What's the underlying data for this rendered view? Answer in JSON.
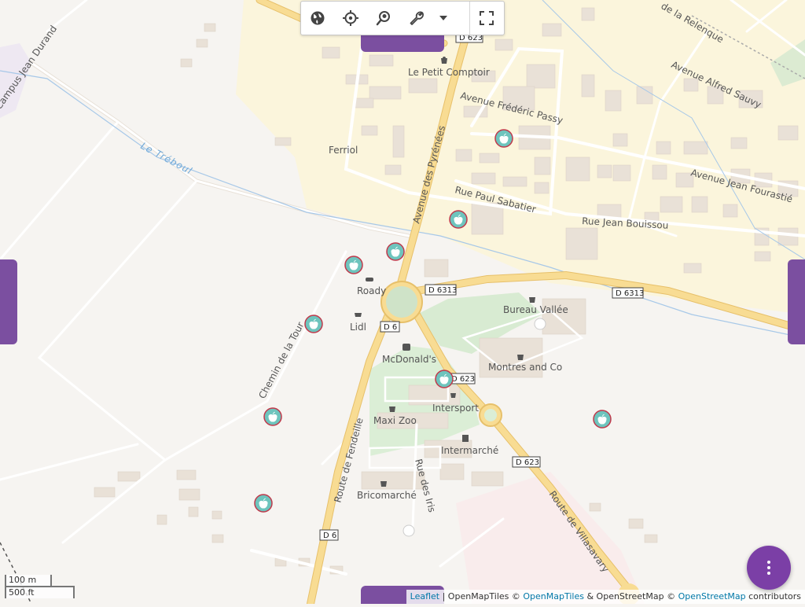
{
  "toolbar": {
    "buttons": [
      {
        "icon": "globe-icon"
      },
      {
        "icon": "crosshair-icon"
      },
      {
        "icon": "search-location-icon"
      },
      {
        "icon": "wrench-icon"
      },
      {
        "icon": "caret-down-icon"
      },
      {
        "icon": "fullscreen-icon"
      }
    ]
  },
  "places": {
    "le_petit_comptoir": "Le Petit Comptoir",
    "ferriol": "Ferriol",
    "roady": "Roady",
    "lidl": "Lidl",
    "mcdonalds": "McDonald's",
    "bureau_vallee": "Bureau Vallée",
    "montres_et_co": "Montres and Co",
    "intersport": "Intersport",
    "maxi_zoo": "Maxi Zoo",
    "intermarche": "Intermarché",
    "bricomarche": "Bricomarché"
  },
  "streets": {
    "campus_jean_durand": "Campus Jean Durand",
    "avenue_des_pyrenees": "Avenue des Pyrénées",
    "avenue_frederic_passy": "Avenue Frédéric Passy",
    "avenue_alfred_sauvy": "Avenue Alfred Sauvy",
    "rue_de_la_relenque": "de la Relenque",
    "avenue_jean_fourastie": "Avenue Jean Fourastié",
    "rue_paul_sabatier": "Rue Paul Sabatier",
    "rue_jean_bouissou": "Rue Jean Bouissou",
    "chemin_de_la_tour": "Chemin de la Tour",
    "route_de_fendeille": "Route de Fendeille",
    "rue_des_iris": "Rue des Iris",
    "route_de_villasavary": "Route de Villasavary",
    "le_treboul": "Le Tréboul"
  },
  "road_shields": {
    "d623_top": "D 623",
    "d6313_left": "D 6313",
    "d6313_right": "D 6313",
    "d6_top": "D 6",
    "d623_mid": "D 623",
    "d623_lower": "D 623",
    "d6_bottom": "D 6"
  },
  "markers": {
    "icon": "apple-icon",
    "color": "#6ec4bd",
    "border_color": "#c0394b",
    "count": 10
  },
  "scale": {
    "metric": "100 m",
    "imperial": "500 ft"
  },
  "attribution": {
    "leaflet": "Leaflet",
    "sep1": " | OpenMapTiles © ",
    "openmaptiles": "OpenMapTiles",
    "sep2": " & OpenStreetMap © ",
    "openstreetmap": "OpenStreetMap",
    "suffix": " contributors"
  },
  "colors": {
    "accent_purple": "#7b3fa6",
    "residential_yellow": "#fbf5dc",
    "road_orange": "#f7d98a",
    "park_green": "#d8ebd2"
  },
  "fab": {
    "icon": "more-vertical-icon"
  }
}
